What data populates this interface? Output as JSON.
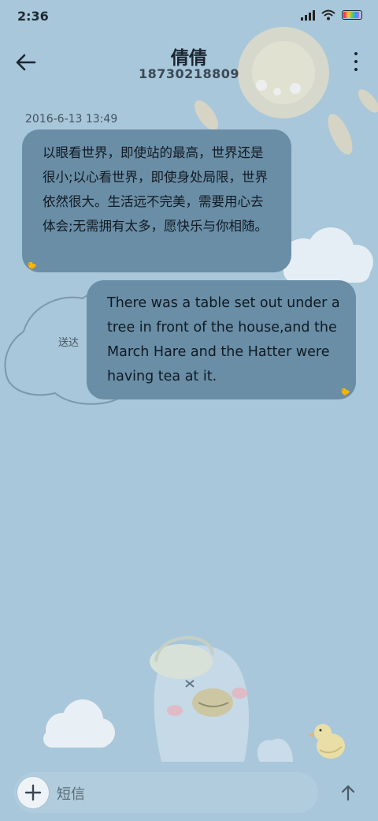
{
  "status_bar": {
    "time": "2:36",
    "battery_icon": "battery-icon",
    "wifi_icon": "wifi-icon",
    "signal_icon": "signal-icon"
  },
  "header": {
    "contact_name": "倩倩",
    "phone_number": "18730218809",
    "back_icon": "back-arrow-icon",
    "more_icon": "more-vertical-icon"
  },
  "conversation": {
    "timestamp": "2016-6-13 13:49",
    "messages": [
      {
        "direction": "incoming",
        "text": "以眼看世界，即使站的最高，世界还是很小;以心看世界，即使身处局限，世界依然很大。生活远不完美，需要用心去体会;无需拥有太多，愿快乐与你相随。"
      },
      {
        "direction": "outgoing",
        "text": "There was a table set out under a tree in front of the house,and the March Hare and the Hatter were having tea at it.",
        "status": "送达"
      }
    ]
  },
  "composer": {
    "placeholder": "短信",
    "attach_icon": "add-attachment-icon",
    "send_icon": "send-arrow-icon"
  },
  "colors": {
    "background": "#a8c7da",
    "bubble": "#6a8ea6",
    "text": "#1e2b36"
  }
}
